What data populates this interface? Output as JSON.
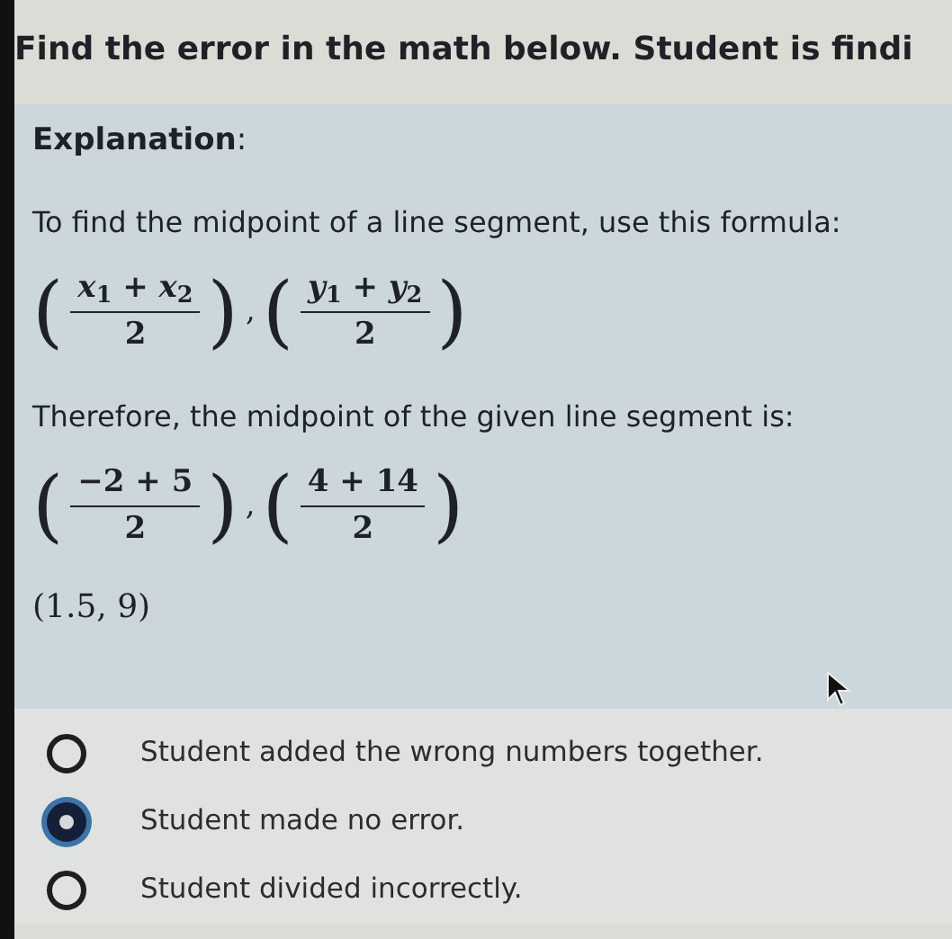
{
  "question": "Find the error in the math below. Student is findi",
  "explanation": {
    "heading": "**Explanation**:",
    "blocks": [
      {
        "kind": "text",
        "text": "To find the midpoint of a line segment, use this formula:"
      },
      {
        "kind": "pair",
        "separator": ",",
        "fractions": [
          {
            "open": "(",
            "numerator": "*x*$_{1}$ + *x*$_{2}$",
            "denominator": "2",
            "close": ")"
          },
          {
            "open": "(",
            "numerator": "*y*$_{1}$ + *y*$_{2}$",
            "denominator": "2",
            "close": ")"
          }
        ]
      },
      {
        "kind": "text",
        "text": "Therefore, the midpoint of the given line segment is:"
      },
      {
        "kind": "pair",
        "separator": ",",
        "fractions": [
          {
            "open": "(",
            "numerator": "−2 + 5",
            "denominator": "2",
            "close": ")"
          },
          {
            "open": "(",
            "numerator": "4 + 14",
            "denominator": "2",
            "close": ")"
          }
        ]
      },
      {
        "kind": "result",
        "text": "(1.5, 9)"
      }
    ]
  },
  "options": [
    {
      "label": "Student added the wrong numbers together.",
      "selected": false
    },
    {
      "label": "Student made no error.",
      "selected": true
    },
    {
      "label": "Student divided incorrectly.",
      "selected": false
    }
  ]
}
